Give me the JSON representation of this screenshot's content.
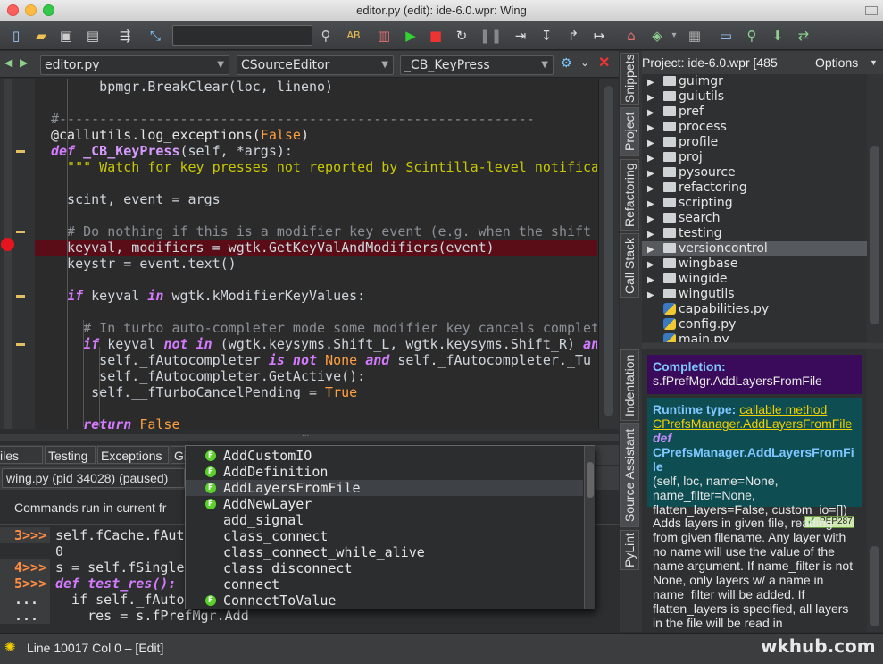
{
  "window": {
    "title": "editor.py (edit): ide-6.0.wpr: Wing"
  },
  "editor": {
    "file": "editor.py",
    "class": "CSourceEditor",
    "function": "_CB_KeyPress",
    "lines": [
      {
        "segs": [
          {
            "t": "      bpmgr.BreakClear(loc, lineno)",
            "c": "nm"
          }
        ]
      },
      {
        "segs": [
          {
            "t": "",
            "c": "nm"
          }
        ]
      },
      {
        "segs": [
          {
            "t": "#-----------------------------------------------------------",
            "c": "cm"
          }
        ]
      },
      {
        "segs": [
          {
            "t": "@callutils.log_exceptions(",
            "c": "dec"
          },
          {
            "t": "False",
            "c": "kwc"
          },
          {
            "t": ")",
            "c": "dec"
          }
        ]
      },
      {
        "segs": [
          {
            "t": "def ",
            "c": "kw"
          },
          {
            "t": "_CB_KeyPress",
            "c": "fn"
          },
          {
            "t": "(self, *args):",
            "c": "nm"
          }
        ]
      },
      {
        "segs": [
          {
            "t": "  \"\"\" Watch for key presses not reported by Scintilla-level notifica",
            "c": "str"
          }
        ]
      },
      {
        "segs": [
          {
            "t": "",
            "c": "nm"
          }
        ]
      },
      {
        "segs": [
          {
            "t": "  scint, event = args",
            "c": "nm"
          }
        ]
      },
      {
        "segs": [
          {
            "t": "",
            "c": "nm"
          }
        ]
      },
      {
        "segs": [
          {
            "t": "  # Do nothing if this is a modifier key event (e.g. when the shift",
            "c": "cm"
          }
        ]
      },
      {
        "segs": [
          {
            "t": "  keyval, modifiers = wgtk.GetKeyValAndModifiers(event)",
            "c": "nm"
          }
        ],
        "bp": true
      },
      {
        "segs": [
          {
            "t": "  keystr = event.text()",
            "c": "nm"
          }
        ]
      },
      {
        "segs": [
          {
            "t": "",
            "c": "nm"
          }
        ]
      },
      {
        "segs": [
          {
            "t": "  ",
            "c": "nm"
          },
          {
            "t": "if ",
            "c": "kw"
          },
          {
            "t": "keyval ",
            "c": "nm"
          },
          {
            "t": "in ",
            "c": "kw"
          },
          {
            "t": "wgtk.kModifierKeyValues:",
            "c": "nm"
          }
        ]
      },
      {
        "segs": [
          {
            "t": "",
            "c": "nm"
          }
        ]
      },
      {
        "segs": [
          {
            "t": "    # In turbo auto-completer mode some modifier key cancels complet",
            "c": "cm"
          }
        ]
      },
      {
        "segs": [
          {
            "t": "    ",
            "c": "nm"
          },
          {
            "t": "if ",
            "c": "kw"
          },
          {
            "t": "keyval ",
            "c": "nm"
          },
          {
            "t": "not in ",
            "c": "kw"
          },
          {
            "t": "(wgtk.keysyms.Shift_L, wgtk.keysyms.Shift_R) ",
            "c": "nm"
          },
          {
            "t": "an",
            "c": "kw"
          }
        ]
      },
      {
        "segs": [
          {
            "t": "      self._fAutocompleter ",
            "c": "nm"
          },
          {
            "t": "is not ",
            "c": "kw"
          },
          {
            "t": "None ",
            "c": "kwc"
          },
          {
            "t": "and ",
            "c": "kw"
          },
          {
            "t": "self._fAutocompleter._Tu",
            "c": "nm"
          }
        ]
      },
      {
        "segs": [
          {
            "t": "      self._fAutocompleter.GetActive():",
            "c": "nm"
          }
        ]
      },
      {
        "segs": [
          {
            "t": "     self.__fTurboCancelPending = ",
            "c": "nm"
          },
          {
            "t": "True",
            "c": "kwc"
          }
        ]
      },
      {
        "segs": [
          {
            "t": "",
            "c": "nm"
          }
        ]
      },
      {
        "segs": [
          {
            "t": "    ",
            "c": "nm"
          },
          {
            "t": "return ",
            "c": "kw"
          },
          {
            "t": "False",
            "c": "kwc"
          }
        ]
      }
    ]
  },
  "bottom": {
    "tabs": [
      "iles",
      "Testing",
      "Exceptions",
      "Git",
      "Br"
    ],
    "process": "wing.py (pid 34028) (paused)",
    "info": "Commands run in current fr",
    "shell": [
      {
        "p": "3>>>",
        "t": "self.fCache.fAut"
      },
      {
        "p": "",
        "t": "0"
      },
      {
        "p": "4>>>",
        "t": "s = self.fSingle"
      },
      {
        "p": "5>>>",
        "t": "def test_res():",
        "kw": true
      },
      {
        "p": "...",
        "t": "  if self._fAuto",
        "kw2": true
      },
      {
        "p": "...",
        "t": "    res = s.fPrefMgr.Add"
      }
    ]
  },
  "completion": [
    {
      "label": "AddCustomIO",
      "badge": true
    },
    {
      "label": "AddDefinition",
      "badge": true
    },
    {
      "label": "AddLayersFromFile",
      "badge": true,
      "selected": true
    },
    {
      "label": "AddNewLayer",
      "badge": true
    },
    {
      "label": "add_signal",
      "badge": false
    },
    {
      "label": "class_connect",
      "badge": false
    },
    {
      "label": "class_connect_while_alive",
      "badge": false
    },
    {
      "label": "class_disconnect",
      "badge": false
    },
    {
      "label": "connect",
      "badge": false
    },
    {
      "label": "ConnectToValue",
      "badge": true
    }
  ],
  "badge_letter": "F",
  "project": {
    "title": "Project: ide-6.0.wpr [485",
    "options": "Options",
    "items": [
      {
        "name": "guimgr",
        "type": "folder"
      },
      {
        "name": "guiutils",
        "type": "folder"
      },
      {
        "name": "pref",
        "type": "folder"
      },
      {
        "name": "process",
        "type": "folder"
      },
      {
        "name": "profile",
        "type": "folder"
      },
      {
        "name": "proj",
        "type": "folder"
      },
      {
        "name": "pysource",
        "type": "folder"
      },
      {
        "name": "refactoring",
        "type": "folder"
      },
      {
        "name": "scripting",
        "type": "folder"
      },
      {
        "name": "search",
        "type": "folder"
      },
      {
        "name": "testing",
        "type": "folder"
      },
      {
        "name": "versioncontrol",
        "type": "folder",
        "selected": true
      },
      {
        "name": "wingbase",
        "type": "folder"
      },
      {
        "name": "wingide",
        "type": "folder"
      },
      {
        "name": "wingutils",
        "type": "folder"
      },
      {
        "name": "capabilities.py",
        "type": "py"
      },
      {
        "name": "config.py",
        "type": "py"
      },
      {
        "name": "main.py",
        "type": "py"
      }
    ]
  },
  "righttabs": {
    "snippets": "Snippets",
    "project": "Project",
    "refactoring": "Refactoring",
    "callstack": "Call Stack",
    "indentation": "Indentation",
    "sourceassistant": "Source Assistant",
    "pylint": "PyLint"
  },
  "assistant": {
    "completion_label": "Completion:",
    "completion_value": "s.fPrefMgr.AddLayersFromFile",
    "runtime_label": "Runtime type:",
    "runtime_link": "callable method",
    "runtime_class": "CPrefsManager.AddLayersFromFile",
    "def_kw": "def",
    "def_name": "CPrefsManager.AddLayersFromFi le",
    "def_args": "(self, loc, name=None, name_filter=None, flatten_layers=False, custom_io=[])",
    "pep": "PEP287",
    "doc": "Adds layers in given file, reading from given filename. Any layer with no name will use the value of the name argument. If name_filter is not None, only layers w/ a name in name_filter will be added. If flatten_layers is specified, all layers in the file will be read in"
  },
  "status": {
    "text": "Line 10017 Col 0 – [Edit]"
  },
  "watermark": "wkhub.com",
  "colors": {
    "accent": "#5ad12a",
    "selection": "#565a5e",
    "breakpoint": "#e8141d",
    "completion_box": "#3a0b5a",
    "runtime_box": "#0e4d52"
  }
}
